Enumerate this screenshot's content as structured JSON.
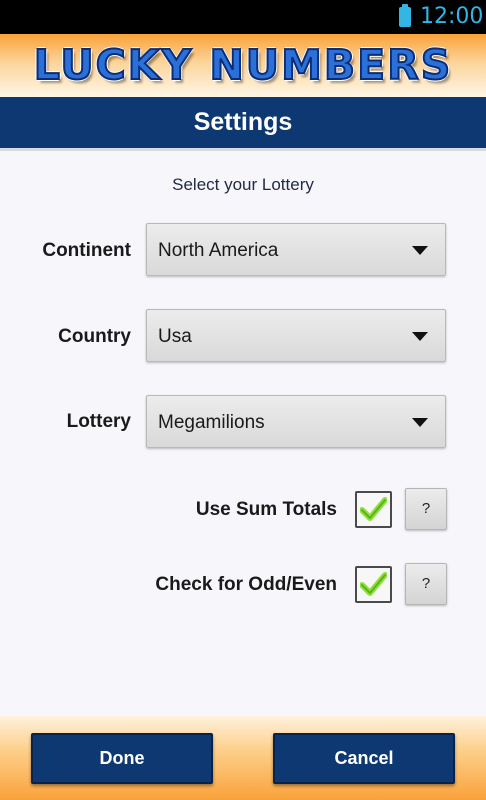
{
  "status_bar": {
    "time": "12:00",
    "battery_icon": "battery-icon"
  },
  "header": {
    "logo_text": "LUCKY NUMBERS"
  },
  "title_bar": {
    "title": "Settings"
  },
  "form": {
    "subtitle": "Select your Lottery",
    "continent": {
      "label": "Continent",
      "value": "North America"
    },
    "country": {
      "label": "Country",
      "value": "Usa"
    },
    "lottery": {
      "label": "Lottery",
      "value": "Megamilions"
    }
  },
  "options": {
    "sum_totals": {
      "label": "Use Sum Totals",
      "checked": true,
      "help": "?"
    },
    "odd_even": {
      "label": "Check for Odd/Even",
      "checked": true,
      "help": "?"
    }
  },
  "buttons": {
    "done": "Done",
    "cancel": "Cancel"
  },
  "colors": {
    "navy": "#0d3872",
    "orange": "#f9a23a",
    "check_green": "#7ed321",
    "status_blue": "#33b5e5"
  }
}
